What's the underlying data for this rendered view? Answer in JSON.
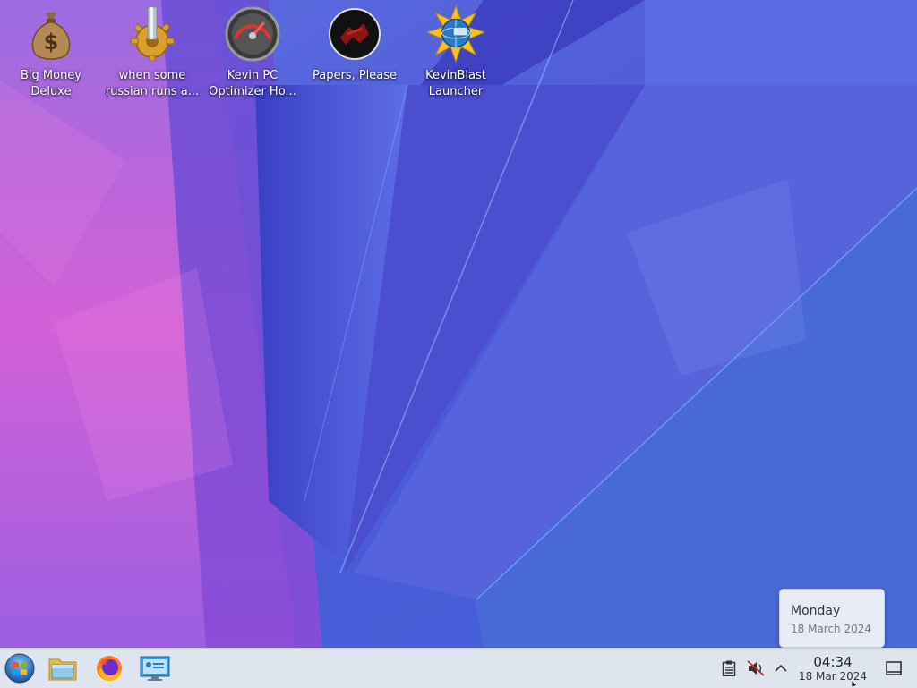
{
  "desktop": {
    "icons": [
      {
        "label": "Big Money\nDeluxe",
        "icon": "money-bag-icon"
      },
      {
        "label": "when some\nrussian runs a...",
        "icon": "gear-icon"
      },
      {
        "label": "Kevin PC\nOptimizer Ho...",
        "icon": "speedometer-icon"
      },
      {
        "label": "Papers, Please",
        "icon": "papers-please-icon"
      },
      {
        "label": "KevinBlast\nLauncher",
        "icon": "globe-burst-icon"
      }
    ]
  },
  "popup": {
    "day": "Monday",
    "date": "18 March 2024"
  },
  "taskbar": {
    "apps": [
      "start-menu-icon",
      "file-manager-icon",
      "firefox-icon",
      "system-settings-icon"
    ],
    "tray": [
      "clipboard-icon",
      "volume-muted-icon",
      "chevron-up-icon"
    ],
    "clock": {
      "time": "04:34",
      "date": "18 Mar 2024"
    },
    "show_desktop": "show-desktop-icon"
  },
  "colors": {
    "taskbar_bg": "#dfe5ef",
    "wallpaper_pink": "#c94fd6",
    "wallpaper_blue": "#3d55d8"
  }
}
